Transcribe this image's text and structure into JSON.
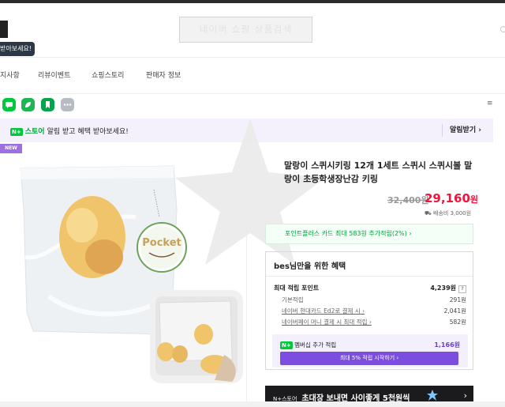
{
  "header": {
    "placeholder_text": "네이버 쇼핑 상품검색",
    "tooltip": "받아보세요!"
  },
  "nav": {
    "items": [
      "지사항",
      "리뷰이벤트",
      "쇼핑스토리",
      "판매자 정보"
    ]
  },
  "share_icons": [
    "talk-icon",
    "band-icon",
    "bookmark-icon",
    "more-dots-icon"
  ],
  "more_label": "≡",
  "alarm": {
    "badge": "N+",
    "store": "스토어",
    "text": "알림 받고 혜택 받아보세요!",
    "button": "알림받기 ›"
  },
  "badge_new": "NEW",
  "product": {
    "title": "말랑이 스퀴시키링 12개 1세트 스퀴시 스퀴시볼 말랑이 초등학생장난감 키링",
    "original_price": "32,400원",
    "sale_price": "29,160",
    "price_unit": "원",
    "shipping": "배송비 3,000원",
    "point_card": "포인트플러스 카드 최대 583원 추가적립(2%) ›",
    "keychain_text": "Pocket"
  },
  "benefit": {
    "title": "bes님만을 위한 혜택",
    "rows": [
      {
        "label": "최대 적립 포인트",
        "value": "4,239원",
        "type": "main",
        "help": "?"
      },
      {
        "label": "기본적립",
        "value": "291원",
        "type": "sub"
      },
      {
        "label": "네이버 현대카드 Ed2로 결제 시 ›",
        "value": "2,041원",
        "type": "sub-link"
      },
      {
        "label": "네이버페이 머니 결제 시 최대 적립 ›",
        "value": "582원",
        "type": "sub-link"
      }
    ],
    "membership_label": "멤버십 추가 적립",
    "membership_value": "1,166원",
    "start_button": "최대 5% 적립 시작하기 ›"
  },
  "promo": {
    "store": "N+스토어",
    "text": "초대장 보내면 사이좋게 5천원씩",
    "arrow": "›"
  },
  "colors": {
    "accent_purple": "#7b4ee0",
    "sale_red": "#f0153c",
    "naver_green": "#00c73c",
    "alarm_bg": "#f4f1fd"
  }
}
